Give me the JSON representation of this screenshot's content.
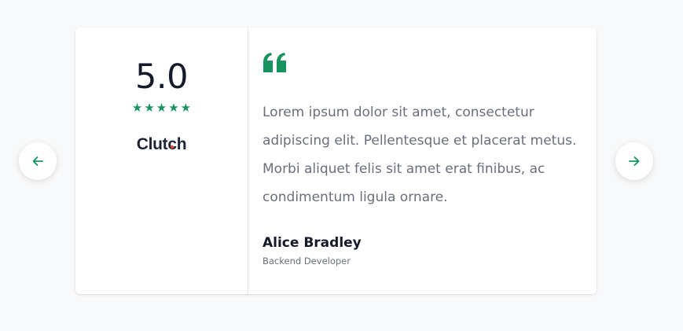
{
  "rating": {
    "score": "5.0",
    "stars": [
      "★",
      "★",
      "★",
      "★",
      "★"
    ],
    "brand": "Clutch"
  },
  "testimonial": {
    "quote_icon": "quote-icon",
    "text": "Lorem ipsum dolor sit amet, consectetur adipiscing elit. Pellentesque et placerat metus. Morbi aliquet felis sit amet erat finibus, ac condimentum ligula ornare.",
    "author_name": "Alice Bradley",
    "author_role": "Backend Developer"
  },
  "navigation": {
    "prev_icon": "arrow-left-icon",
    "next_icon": "arrow-right-icon"
  },
  "colors": {
    "accent": "#16935f",
    "heading": "#141a2a",
    "body_text": "#6a6f7c",
    "background": "#f8f9fa",
    "card": "#ffffff"
  }
}
